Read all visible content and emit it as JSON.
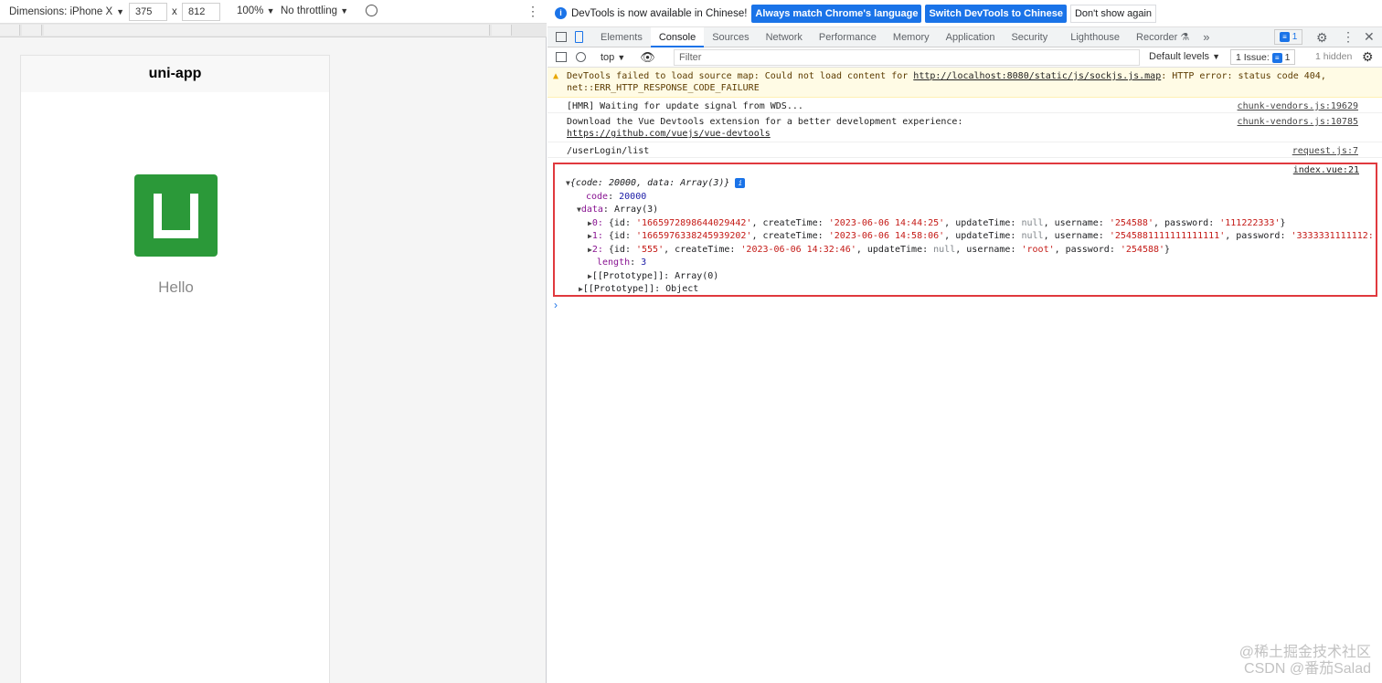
{
  "device_toolbar": {
    "dimensions_label": "Dimensions: iPhone X",
    "width": "375",
    "x": "x",
    "height": "812",
    "zoom": "100%",
    "throttling": "No throttling"
  },
  "app": {
    "nav_title": "uni-app",
    "hello": "Hello",
    "logo_color": "#2b9939"
  },
  "infobar": {
    "text": "DevTools is now available in Chinese!",
    "btn_match": "Always match Chrome's language",
    "btn_switch": "Switch DevTools to Chinese",
    "btn_dont": "Don't show again"
  },
  "tabs": [
    "Elements",
    "Console",
    "Sources",
    "Network",
    "Performance",
    "Memory",
    "Application",
    "Security",
    "Lighthouse",
    "Recorder"
  ],
  "tabbar": {
    "issues_count": "1"
  },
  "console_bar": {
    "context": "top",
    "filter_placeholder": "Filter",
    "levels": "Default levels",
    "issues": "1 Issue:",
    "issues_count": "1",
    "hidden": "1 hidden"
  },
  "messages": {
    "warn_line1": "DevTools failed to load source map: Could not load content for ",
    "warn_url": "http://localhost:8080/static/js/sockjs.js.map",
    "warn_line1_end": ": HTTP error: status code 404,",
    "warn_line2": "net::ERR_HTTP_RESPONSE_CODE_FAILURE",
    "hmr": "[HMR] Waiting for update signal from WDS...",
    "hmr_src": "chunk-vendors.js:19629",
    "vue1": "Download the Vue Devtools extension for a better development experience:",
    "vue_url": "https://github.com/vuejs/vue-devtools",
    "vue_src": "chunk-vendors.js:10785",
    "userlogin": "/userLogin/list",
    "userlogin_src": "request.js:7",
    "obj_src": "index.vue:21"
  },
  "object": {
    "summary": "{code: 20000, data: Array(3)}",
    "code_key": "code",
    "code_val": "20000",
    "data_key": "data",
    "data_val": "Array(3)",
    "rows": [
      {
        "idx": "0:",
        "id": "'1665972898644029442'",
        "ct": "'2023-06-06 14:44:25'",
        "user": "'254588'",
        "pass": "'111222333'",
        "end": "}"
      },
      {
        "idx": "1:",
        "id": "'1665976338245939202'",
        "ct": "'2023-06-06 14:58:06'",
        "user": "'2545881111111111111'",
        "pass": "'3333331111112:",
        "end": ""
      },
      {
        "idx": "2:",
        "id": "'555'",
        "ct": "'2023-06-06 14:32:46'",
        "user": "'root'",
        "pass": "'254588'",
        "end": "}"
      }
    ],
    "length_key": "length",
    "length_val": "3",
    "proto_arr": "[[Prototype]]: Array(0)",
    "proto_obj": "[[Prototype]]: Object"
  },
  "watermark": {
    "line1": "@稀土掘金技术社区",
    "line2": "CSDN @番茄Salad"
  }
}
